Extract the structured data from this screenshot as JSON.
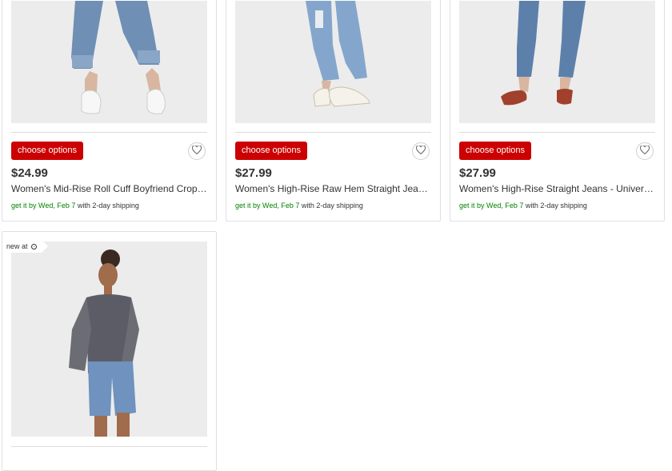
{
  "products": [
    {
      "button_label": "choose options",
      "price": "$24.99",
      "title": "Women's Mid-Rise Roll Cuff Boyfriend Crop J...",
      "ship_date": "get it by Wed, Feb 7",
      "ship_method": " with 2-day shipping",
      "image_name": "product-image-boyfriend-crop-jeans"
    },
    {
      "button_label": "choose options",
      "price": "$27.99",
      "title": "Women's High-Rise Raw Hem Straight Jeans ...",
      "ship_date": "get it by Wed, Feb 7",
      "ship_method": " with 2-day shipping",
      "image_name": "product-image-raw-hem-straight-jeans"
    },
    {
      "button_label": "choose options",
      "price": "$27.99",
      "title": "Women's High-Rise Straight Jeans - Universa...",
      "ship_date": "get it by Wed, Feb 7",
      "ship_method": " with 2-day shipping",
      "image_name": "product-image-high-rise-straight-jeans"
    },
    {
      "badge": "new at",
      "badge_icon": "target-logo-icon",
      "image_name": "product-image-gingham-top-denim-shorts"
    }
  ],
  "colors": {
    "button": "#cc0000",
    "shipping_green": "#008300",
    "text": "#333333"
  }
}
